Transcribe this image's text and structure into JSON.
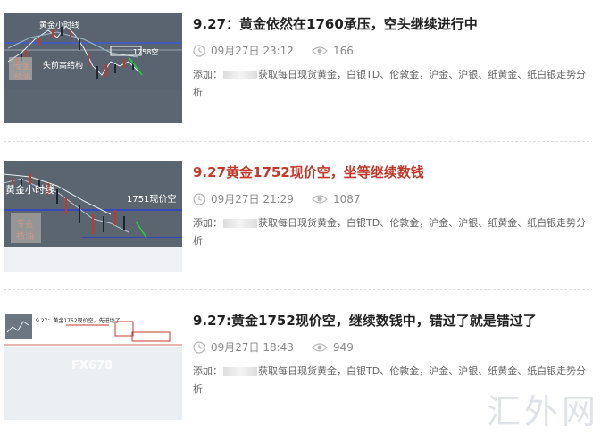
{
  "articles": [
    {
      "title": "9.27：黄金依然在1760承压，空头继续进行中",
      "title_color": "#222222",
      "date": "09月27日 23:12",
      "views": "166",
      "desc_prefix": "添加：",
      "desc_body": "获取每日现货黄金，白银TD、伦敦金，沪金、沪银、纸黄金、纸白银走势分析",
      "thumb_labels": [
        "黄金小时线",
        "失前高结构",
        "1758空",
        "专金",
        "枝油"
      ]
    },
    {
      "title": "9.27黄金1752现价空，坐等继续数钱",
      "title_color": "#c0392b",
      "date": "09月27日 21:29",
      "views": "1087",
      "desc_prefix": "添加：",
      "desc_body": "获取每日现货黄金，白银TD、伦敦金，沪金、沪银、纸黄金、纸白银走势分析",
      "thumb_labels": [
        "黄金小时线",
        "1751现价空",
        "专金",
        "枝油"
      ]
    },
    {
      "title": "9.27:黄金1752现价空，继续数钱中，错过了就是错过了",
      "title_color": "#222222",
      "date": "09月27日 18:43",
      "views": "949",
      "desc_prefix": "添加：",
      "desc_body": "获取每日现货黄金，白银TD、伦敦金，沪金、沪银、纸黄金、纸白银走势分析",
      "thumb_labels": [
        "9.27：黄金1752现价空，先进场了",
        "FX678"
      ]
    }
  ],
  "icons": {
    "clock": "clock-icon",
    "views": "eye-icon"
  },
  "watermark": "汇外网"
}
